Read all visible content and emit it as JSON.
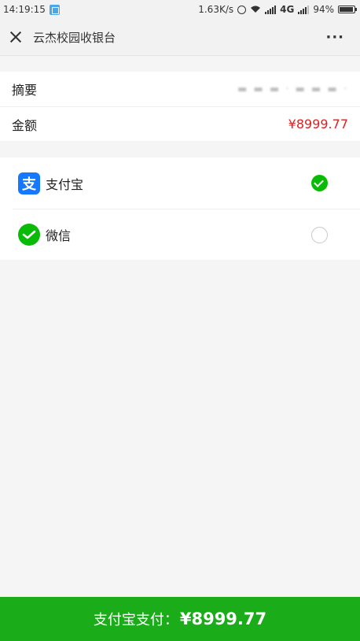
{
  "status_bar": {
    "time": "14:19:15",
    "speed": "1.63K/s",
    "network": "4G",
    "battery": "94%",
    "battery_level": 0.94
  },
  "navbar": {
    "title": "云杰校园收银台",
    "more": "···"
  },
  "order": {
    "summary_label": "摘要",
    "summary_value": "▬ ▬ ▬ · ▬ ▬ ▬ ·",
    "amount_label": "金额",
    "amount_value": "¥8999.77"
  },
  "payment_methods": [
    {
      "label": "支付宝",
      "icon": "alipay-icon",
      "selected": true
    },
    {
      "label": "微信",
      "icon": "wechat-icon",
      "selected": false
    }
  ],
  "pay_button": {
    "label": "支付宝支付：",
    "amount": "¥8999.77"
  },
  "colors": {
    "accent_green": "#1aad19",
    "amount_red": "#e02020",
    "alipay_blue": "#1677ff"
  }
}
